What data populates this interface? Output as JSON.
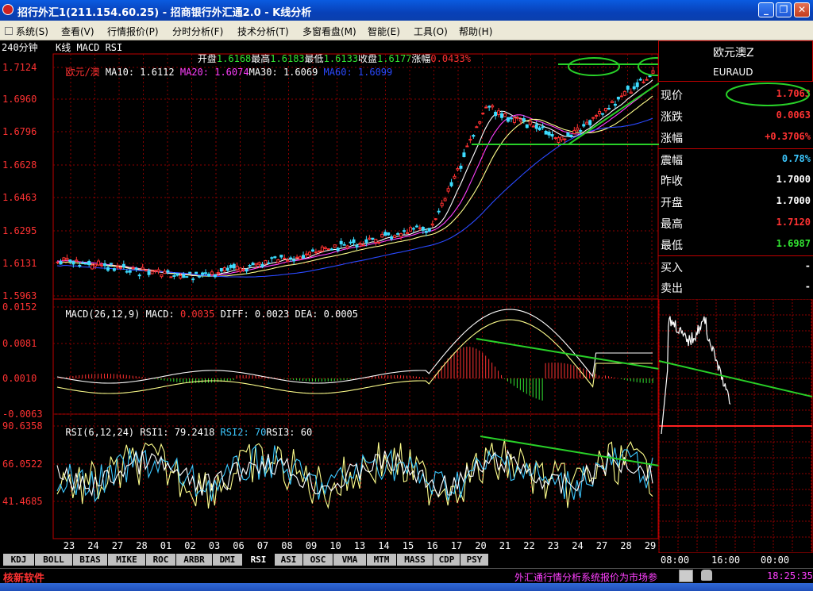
{
  "window": {
    "title": "招行外汇1(211.154.60.25) - 招商银行外汇通2.0 - K线分析",
    "buttons": {
      "minimize": "_",
      "restore": "❐",
      "close": "✕"
    }
  },
  "menu": [
    "系统(S)",
    "查看(V)",
    "行情报价(P)",
    "分时分析(F)",
    "技术分析(T)",
    "多窗看盘(M)",
    "智能(E)",
    "工具(O)",
    "帮助(H)"
  ],
  "info": {
    "period": "240分钟",
    "indicators": "K线 MACD RSI",
    "open_label": "开盘",
    "open": "1.6168",
    "high_label": "最高",
    "high": "1.6183",
    "low_label": "最低",
    "low": "1.6133",
    "close_label": "收盘",
    "close": "1.6177",
    "change_label": "涨幅",
    "change": "0.0433%"
  },
  "main_chart": {
    "symbol": "欧元/澳",
    "ma10_label": "MA10:",
    "ma10": "1.6112",
    "ma20_label": "MA20:",
    "ma20": "1.6074",
    "ma30_label": "MA30:",
    "ma30": "1.6069",
    "ma60_label": "MA60:",
    "ma60": "1.6099",
    "y_ticks": [
      "1.7124",
      "1.6960",
      "1.6796",
      "1.6628",
      "1.6463",
      "1.6295",
      "1.6131",
      "1.5963"
    ]
  },
  "macd_panel": {
    "label": "MACD(26,12,9) MACD:",
    "macd": "0.0035",
    "diff_label": "DIFF:",
    "diff": "0.0023",
    "dea_label": "DEA:",
    "dea": "0.0005",
    "y_ticks": [
      "0.0152",
      "0.0081",
      "0.0010",
      "-0.0063"
    ]
  },
  "rsi_panel": {
    "label": "RSI(6,12,24) RSI1:",
    "rsi1": "79.2418",
    "rsi2_label": "RSI2:",
    "rsi2": "70",
    "rsi3_label": "RSI3:",
    "rsi3": "60",
    "y_ticks": [
      "90.6358",
      "66.0522",
      "41.4685"
    ]
  },
  "x_axis": [
    "23",
    "24",
    "27",
    "28",
    "01",
    "02",
    "03",
    "06",
    "07",
    "08",
    "09",
    "10",
    "13",
    "14",
    "15",
    "16",
    "17",
    "20",
    "21",
    "22",
    "23",
    "24",
    "27",
    "28",
    "29"
  ],
  "quote": {
    "name": "欧元澳Z",
    "code": "EURAUD",
    "rows": [
      {
        "label": "现价",
        "value": "1.7063",
        "color": "#ff3232"
      },
      {
        "label": "涨跌",
        "value": "0.0063",
        "color": "#ff3232"
      },
      {
        "label": "涨幅",
        "value": "+0.3706%",
        "color": "#ff3232"
      },
      {
        "label": "震幅",
        "value": "0.78%",
        "color": "#3cc8ff"
      },
      {
        "label": "昨收",
        "value": "1.7000",
        "color": "#ffffff"
      },
      {
        "label": "开盘",
        "value": "1.7000",
        "color": "#ffffff"
      },
      {
        "label": "最高",
        "value": "1.7120",
        "color": "#ff3232"
      },
      {
        "label": "最低",
        "value": "1.6987",
        "color": "#32e632"
      },
      {
        "label": "买入",
        "value": "-",
        "color": "#ffffff"
      },
      {
        "label": "卖出",
        "value": "-",
        "color": "#ffffff"
      }
    ]
  },
  "intraday_axis": [
    "08:00",
    "16:00",
    "00:00"
  ],
  "tabs": [
    "KDJ",
    "BOLL",
    "BIAS",
    "MIKE",
    "ROC",
    "ARBR",
    "DMI",
    "RSI",
    "ASI",
    "OSC",
    "VMA",
    "MTM",
    "MASS",
    "CDP",
    "PSY"
  ],
  "active_tab": "RSI",
  "status": {
    "brand": "核新软件",
    "ticker": "外汇通行情分析系统报价为市场参",
    "time": "18:25:35"
  }
}
